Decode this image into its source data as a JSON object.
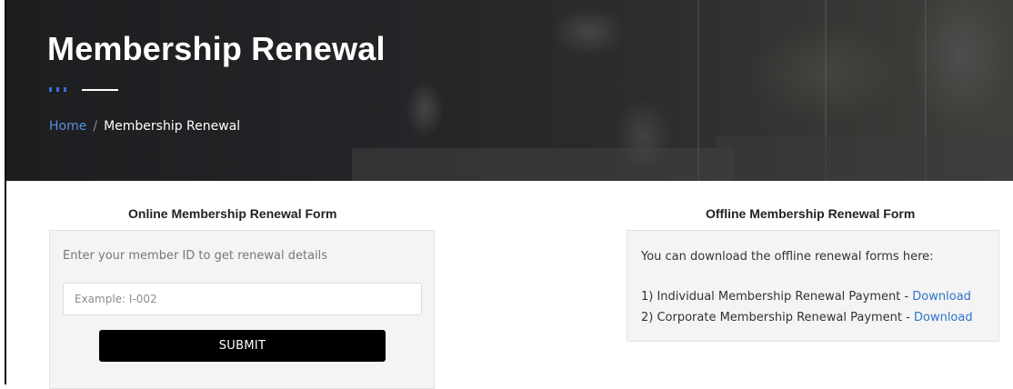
{
  "hero": {
    "title": "Membership Renewal",
    "breadcrumb": {
      "home": "Home",
      "separator": "/",
      "current": "Membership Renewal"
    }
  },
  "online": {
    "title": "Online Membership Renewal Form",
    "hint": "Enter your member ID to get renewal details",
    "member_id": {
      "value": "",
      "placeholder": "Example: I-002"
    },
    "submit_label": "SUBMIT"
  },
  "offline": {
    "title": "Offline Membership Renewal Form",
    "intro": "You can download the offline renewal forms here:",
    "items": [
      {
        "label": "1) Individual Membership Renewal Payment - ",
        "link": "Download"
      },
      {
        "label": "2) Corporate Membership Renewal Payment - ",
        "link": "Download"
      }
    ]
  },
  "colors": {
    "accent_link": "#2f73c9",
    "breadcrumb_link": "#5b8ddb",
    "submit_bg": "#000000",
    "dots": "#3b6fd4"
  }
}
